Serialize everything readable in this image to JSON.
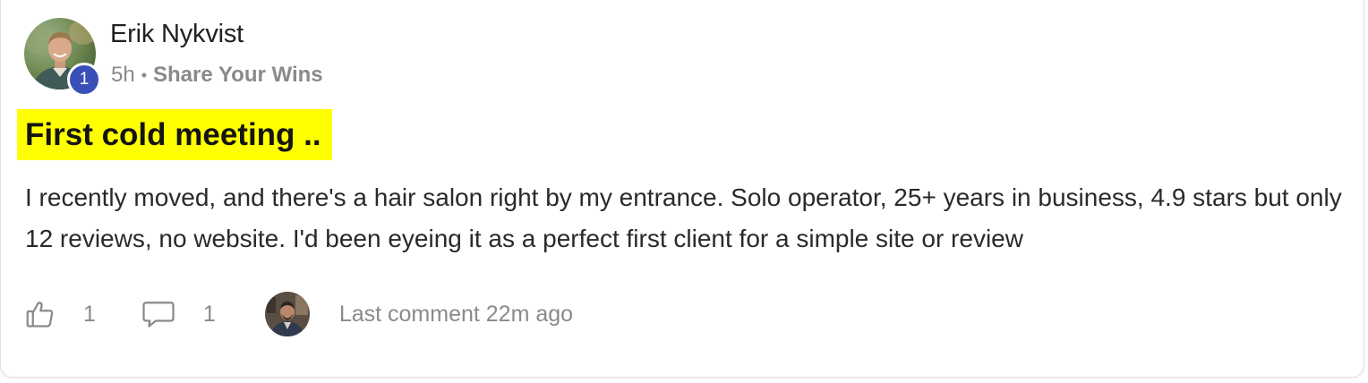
{
  "post": {
    "author": "Erik Nykvist",
    "level": "1",
    "time": "5h",
    "separator": "•",
    "category": "Share Your Wins",
    "title": "First cold meeting ..",
    "body": "I recently moved, and there's a hair salon right by my entrance. Solo operator, 25+ years in business, 4.9 stars but only 12 reviews, no website. I'd been eyeing it as a perfect first client for a simple site or review"
  },
  "footer": {
    "like_count": "1",
    "comment_count": "1",
    "last_comment": "Last comment 22m ago"
  },
  "icons": {
    "like": "thumbs-up-icon",
    "comment": "comment-bubble-icon"
  },
  "colors": {
    "title_highlight": "#ffff00",
    "level_badge": "#3b4fb8",
    "muted_text": "#8a8a8a"
  }
}
